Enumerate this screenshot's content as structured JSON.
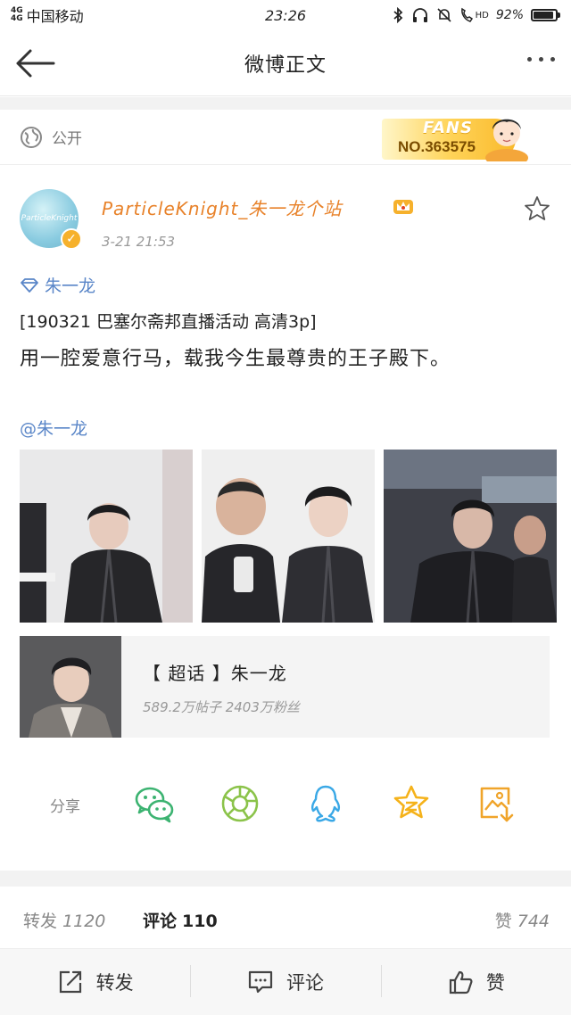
{
  "status_bar": {
    "network": "4G",
    "network_second": "4G",
    "carrier": "中国移动",
    "time": "23:26",
    "battery": "92%",
    "battery_level": 0.92,
    "hd_label": "HD"
  },
  "nav": {
    "title": "微博正文"
  },
  "visibility": {
    "label": "公开"
  },
  "fans_badge": {
    "title": "FANS",
    "number": "NO.363575"
  },
  "post": {
    "author": "ParticleKnight_朱一龙个站",
    "avatar_text": "ParticleKnight",
    "time": "3-21 21:53",
    "topic": "朱一龙",
    "text_line1": "[190321 巴塞尔斋邦直播活动 高清3p]",
    "text_line2": "用一腔爱意行马，载我今生最尊贵的王子殿下。",
    "mention": "@朱一龙"
  },
  "super_topic": {
    "title": "【 超话 】朱一龙",
    "stats": "589.2万帖子  2403万粉丝"
  },
  "share": {
    "label": "分享"
  },
  "stats": {
    "repost_label": "转发",
    "repost_count": "1120",
    "comment_label": "评论",
    "comment_count": "110",
    "like_label": "赞",
    "like_count": "744"
  },
  "bottom_bar": {
    "repost": "转发",
    "comment": "评论",
    "like": "赞"
  },
  "colors": {
    "link_blue": "#5a86c8",
    "name_orange": "#e8822a",
    "wechat_green": "#3cb371",
    "moments_green": "#8bc34a",
    "qq_blue": "#3aa8e6",
    "favorite_gold": "#f5b21a",
    "save_orange": "#f0a42a"
  },
  "icons": {
    "back": "arrow-left-icon",
    "more": "more-dots-icon",
    "globe": "globe-icon",
    "star": "star-outline-icon",
    "wechat": "wechat-icon",
    "moments": "moments-icon",
    "qq": "qq-icon",
    "favorite": "favorite-star-icon",
    "save_image": "save-image-icon",
    "repost": "repost-icon",
    "comment": "comment-icon",
    "like": "thumbs-up-icon"
  }
}
